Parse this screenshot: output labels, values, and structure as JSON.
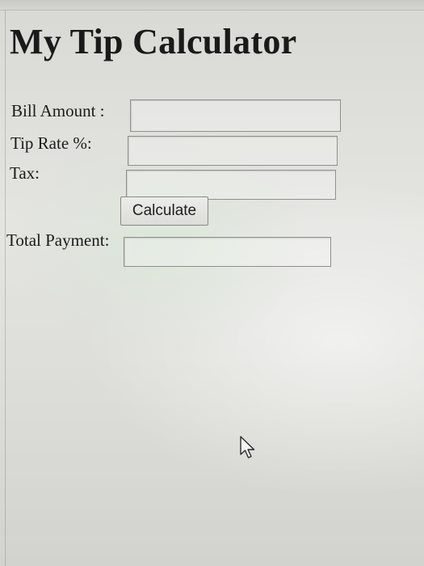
{
  "page": {
    "title": "My Tip Calculator"
  },
  "form": {
    "bill_amount": {
      "label": "Bill Amount :",
      "value": "",
      "placeholder": ""
    },
    "tip_rate": {
      "label": "Tip Rate %:",
      "value": "",
      "placeholder": ""
    },
    "tax": {
      "label": "Tax:",
      "value": "",
      "placeholder": ""
    },
    "calculate_button": {
      "label": "Calculate"
    },
    "total_payment": {
      "label": "Total Payment:",
      "value": "",
      "placeholder": ""
    }
  },
  "icons": {
    "cursor": "mouse-pointer-icon"
  }
}
